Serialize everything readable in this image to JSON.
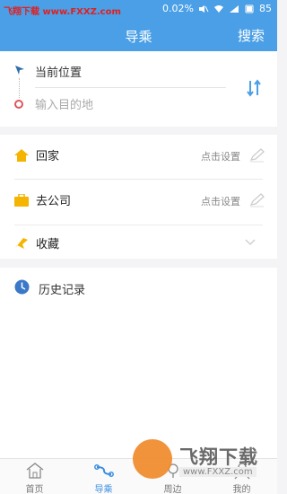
{
  "status_bar": {
    "watermark": "飞翔下载 www.FXXZ.com",
    "speed": "0.02",
    "speed_unit": "%",
    "battery": "85"
  },
  "header": {
    "title": "导乘",
    "search_label": "搜索"
  },
  "route": {
    "start_label": "当前位置",
    "destination_placeholder": "输入目的地"
  },
  "favorites": {
    "home_label": "回家",
    "home_hint": "点击设置",
    "work_label": "去公司",
    "work_hint": "点击设置",
    "collect_label": "收藏"
  },
  "history": {
    "label": "历史记录"
  },
  "bottom_nav": {
    "items": [
      {
        "label": "首页",
        "icon": "home-icon"
      },
      {
        "label": "导乘",
        "icon": "route-icon"
      },
      {
        "label": "周边",
        "icon": "nearby-icon"
      },
      {
        "label": "我的",
        "icon": "user-icon"
      }
    ],
    "active_index": 1
  },
  "watermark_bottom": {
    "title": "飞翔下载",
    "url": "www.FXXZ.com"
  },
  "colors": {
    "accent": "#4a9fe6",
    "home_icon": "#f4b400",
    "end_marker": "#e05560",
    "active_tab": "#3b8fe0"
  }
}
